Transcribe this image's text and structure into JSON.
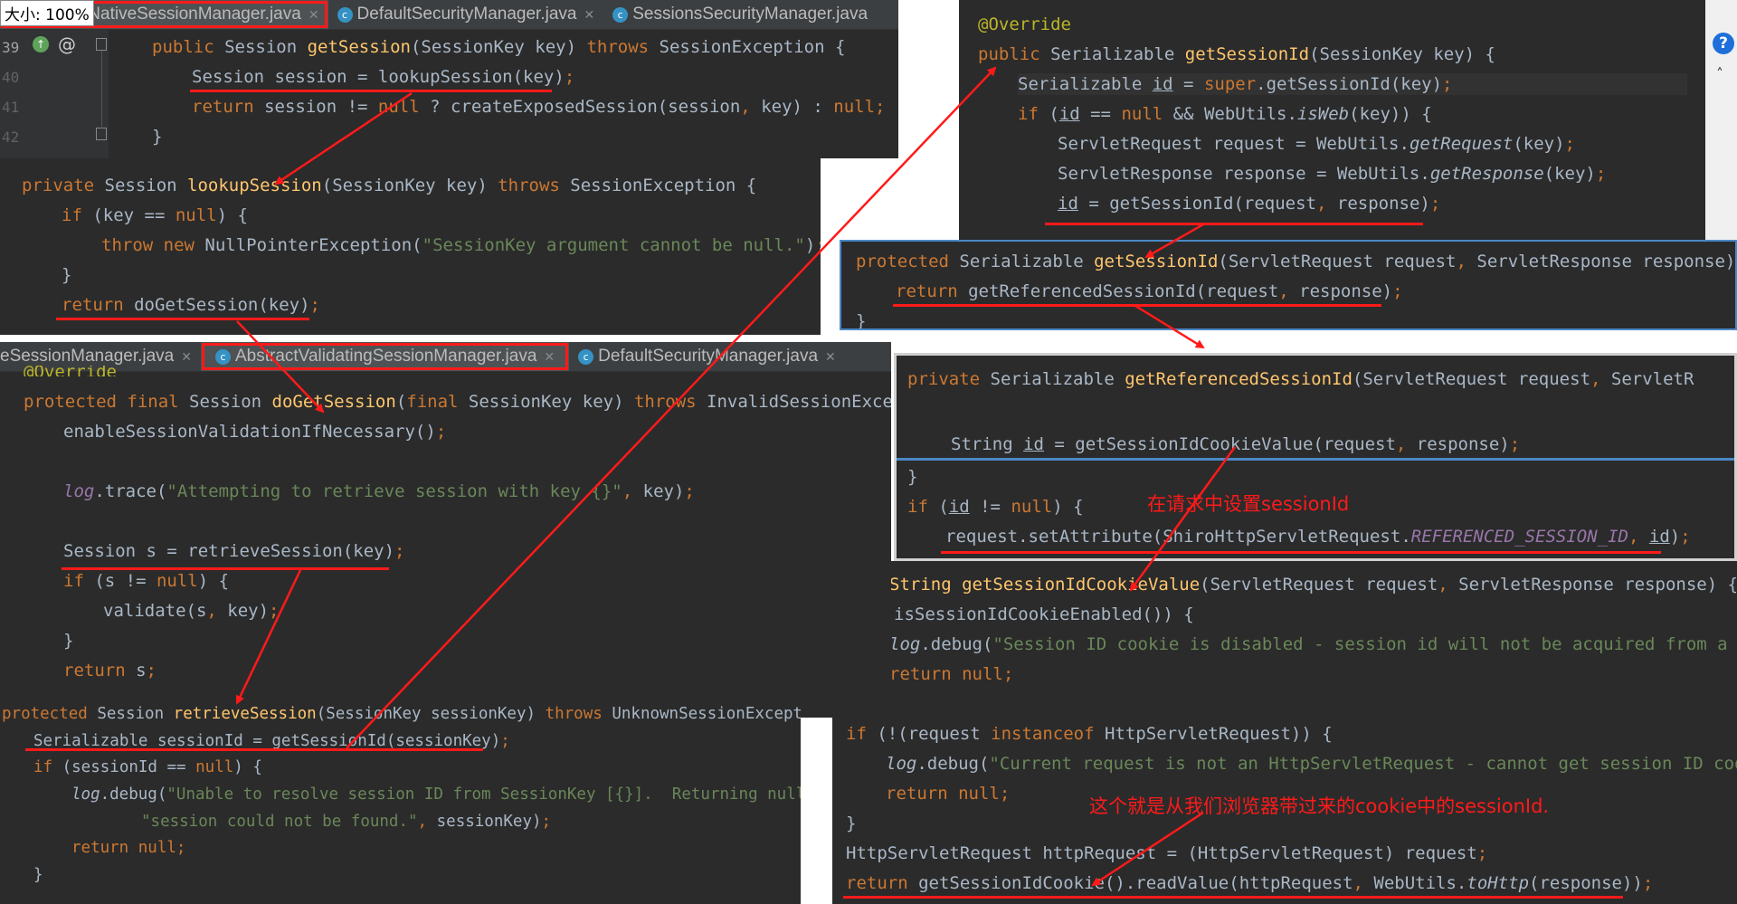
{
  "tabs_top": {
    "zoom": "大小: 100%",
    "tab1": "tNativeSessionManager.java",
    "tab2": "DefaultSecurityManager.java",
    "tab3": "SessionsSecurityManager.java"
  },
  "tabs_mid": {
    "tab1": "eSessionManager.java",
    "tab2": "AbstractValidatingSessionManager.java",
    "tab3": "DefaultSecurityManager.java"
  },
  "gutter": {
    "l1": "39",
    "l2": "40",
    "l3": "41",
    "l4": "42"
  },
  "annotations": {
    "set_session_id": "在请求中设置sessionId",
    "cookie_session_id": "这个就是从我们浏览器带过来的cookie中的sessionId."
  },
  "code": {
    "p1": [
      "public Session getSession(SessionKey key) throws SessionException {",
      "Session session = lookupSession(key);",
      "return session != null ? createExposedSession(session, key) : null;",
      "}"
    ],
    "p2": [
      "private Session lookupSession(SessionKey key) throws SessionException {",
      "if (key == null) {",
      "throw new NullPointerException(\"SessionKey argument cannot be null.\");",
      "}",
      "return doGetSession(key);"
    ],
    "p3": [
      "@Override",
      "protected final Session doGetSession(final SessionKey key) throws InvalidSessionExcepti",
      "enableSessionValidationIfNecessary();",
      "log.trace(\"Attempting to retrieve session with key {}\", key);",
      "Session s = retrieveSession(key);",
      "if (s != null) {",
      "validate(s, key);",
      "}",
      "return s;"
    ],
    "p4": [
      "protected Session retrieveSession(SessionKey sessionKey) throws UnknownSessionException {",
      "Serializable sessionId = getSessionId(sessionKey);",
      "if (sessionId == null) {",
      "log.debug(\"Unable to resolve session ID from SessionKey [{}].  Returning null to i",
      "\"session could not be found.\", sessionKey);",
      "return null;",
      "}"
    ],
    "p5": [
      "@Override",
      "public Serializable getSessionId(SessionKey key) {",
      "Serializable id = super.getSessionId(key);",
      "if (id == null && WebUtils.isWeb(key)) {",
      "ServletRequest request = WebUtils.getRequest(key);",
      "ServletResponse response = WebUtils.getResponse(key);",
      "id = getSessionId(request, response);"
    ],
    "p6": [
      "protected Serializable getSessionId(ServletRequest request, ServletResponse response) {",
      "return getReferencedSessionId(request, response);",
      "}"
    ],
    "p7": [
      "private Serializable getReferencedSessionId(ServletRequest request, ServletR",
      "String id = getSessionIdCookieValue(request, response);",
      "}",
      "if (id != null) {",
      "request.setAttribute(ShiroHttpServletRequest.REFERENCED_SESSION_ID, id);"
    ],
    "p8": [
      "String getSessionIdCookieValue(ServletRequest request, ServletResponse response) {",
      "isSessionIdCookieEnabled()) {",
      "log.debug(\"Session ID cookie is disabled - session id will not be acquired from a requ",
      "return null;",
      "if (!(request instanceof HttpServletRequest)) {",
      "log.debug(\"Current request is not an HttpServletRequest - cannot get session ID cookie",
      "return null;",
      "}",
      "HttpServletRequest httpRequest = (HttpServletRequest) request;",
      "return getSessionIdCookie().readValue(httpRequest, WebUtils.toHttp(response));"
    ]
  },
  "colors": {
    "editor_bg": "#2b2b2b",
    "keyword": "#cc7832",
    "method": "#ffc66d",
    "string": "#6a8759",
    "text": "#a9b7c6",
    "annotation_red": "#ff1a1a"
  }
}
